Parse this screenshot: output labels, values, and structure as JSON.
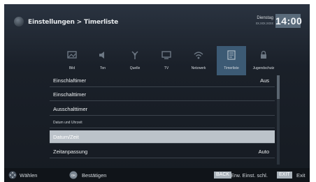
{
  "header": {
    "breadcrumb": "Einstellungen > Timerliste",
    "day": "Dienstag",
    "date": "xx.xxx.xxxx",
    "clock": "14:00"
  },
  "tabs": [
    {
      "label": "Bild",
      "icon": "picture-icon",
      "active": false
    },
    {
      "label": "Ton",
      "icon": "speaker-icon",
      "active": false
    },
    {
      "label": "Quelle",
      "icon": "source-icon",
      "active": false
    },
    {
      "label": "TV",
      "icon": "tv-icon",
      "active": false
    },
    {
      "label": "Netzwerk",
      "icon": "network-icon",
      "active": false
    },
    {
      "label": "Timerliste",
      "icon": "timer-list-icon",
      "active": true
    },
    {
      "label": "Jugendschutz",
      "icon": "parental-lock-icon",
      "active": false
    }
  ],
  "menu": [
    {
      "label": "Einschlaftimer",
      "value": "Aus"
    },
    {
      "label": "Einschalttimer",
      "value": ""
    },
    {
      "label": "Ausschalttimer",
      "value": ""
    },
    {
      "label": "Datum und Uhrzeit",
      "value": "",
      "section": true
    },
    {
      "label": "Datum/Zeit",
      "value": "",
      "selected": true
    },
    {
      "label": "Zeitanpassung",
      "value": "Auto"
    }
  ],
  "footer": {
    "select_label": "Wählen",
    "ok_key": "OK",
    "confirm_label": "Bestätigen",
    "back_key": "BACK",
    "back_label": "Erw. Einst. schl.",
    "exit_key": "EXIT",
    "exit_label": "Exit"
  },
  "colors": {
    "selected_row": "#bcc3ca",
    "active_tab": "#3c5a74",
    "clock_bg": "#5a6b7b"
  }
}
